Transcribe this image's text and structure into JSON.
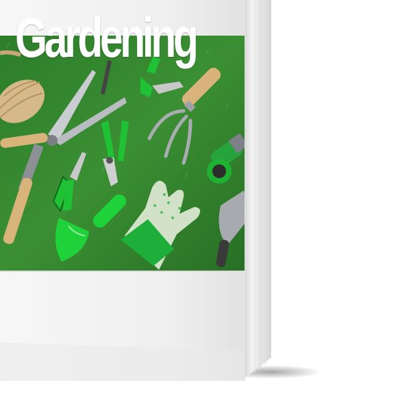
{
  "book": {
    "title": "Gardening",
    "colors": {
      "grass": "#2f7a2a",
      "grass_light": "#3f9a35",
      "tool_green": "#1fc234",
      "handle_wood": "#d9b47a",
      "cover_white": "#f4f4f4",
      "spine": "#dcdcdc"
    },
    "cover_image_items": [
      "twine",
      "hedge-shears",
      "pruning-shears",
      "hand-fork",
      "hose-nozzle",
      "trowel",
      "gloves",
      "steel-trowel"
    ]
  }
}
